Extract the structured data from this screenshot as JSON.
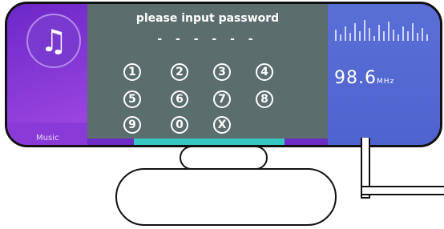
{
  "dialog": {
    "title": "please input password",
    "dashes": "- - - - - -",
    "keys": [
      "1",
      "2",
      "3",
      "4",
      "5",
      "6",
      "7",
      "8",
      "9",
      "0",
      "X"
    ]
  },
  "music": {
    "icon": "music-note-icon",
    "label": "Music"
  },
  "radio": {
    "frequency": "98.6",
    "unit": "MHz"
  },
  "colors": {
    "purple": "#7a3ad0",
    "dialog": "#5c6d6d",
    "teal": "#35c8c2",
    "blue": "#5a6fd6"
  }
}
